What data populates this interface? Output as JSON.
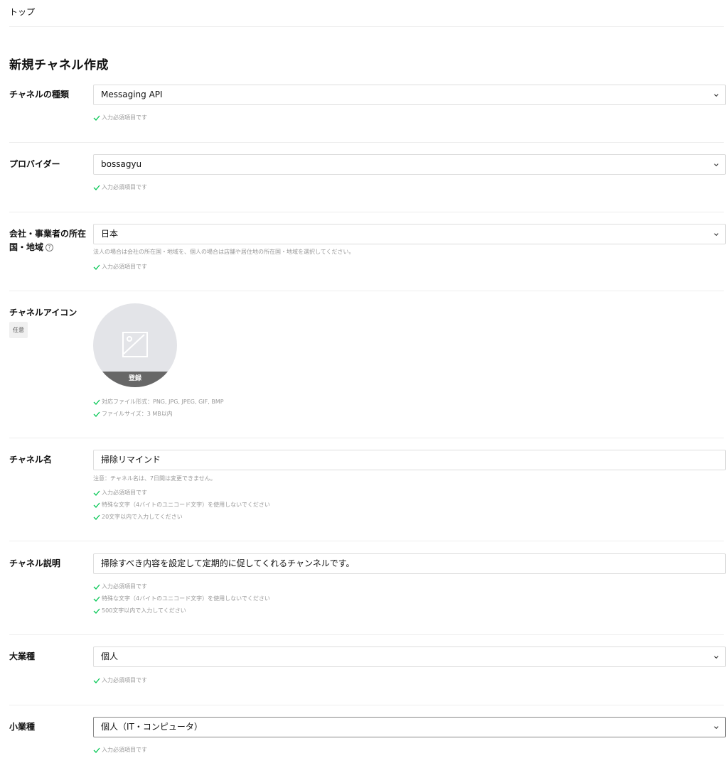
{
  "breadcrumb": "トップ",
  "page_title": "新規チャネル作成",
  "colors": {
    "valid_check": "#06c755",
    "border": "#dddddd",
    "divider": "#eeeeee"
  },
  "form": {
    "channel_type": {
      "label": "チャネルの種類",
      "value": "Messaging API",
      "valid": "入力必須項目です"
    },
    "provider": {
      "label": "プロバイダー",
      "value": "bossagyu",
      "valid": "入力必須項目です"
    },
    "country": {
      "label": "会社・事業者の所在国・地域",
      "help_icon": "help-icon",
      "value": "日本",
      "note": "法人の場合は会社の所在国・地域を、個人の場合は店舗や居住地の所在国・地域を選択してください。",
      "valid": "入力必須項目です"
    },
    "channel_icon": {
      "label": "チャネルアイコン",
      "badge": "任意",
      "register_label": "登録",
      "valid_1": "対応ファイル形式：PNG, JPG, JPEG, GIF, BMP",
      "valid_2": "ファイルサイズ：3 MB以内"
    },
    "channel_name": {
      "label": "チャネル名",
      "value": "掃除リマインド",
      "note": "注意：チャネル名は、7日間は変更できません。",
      "valid_1": "入力必須項目です",
      "valid_2": "特殊な文字（4バイトのユニコード文字）を使用しないでください",
      "valid_3": "20文字以内で入力してください"
    },
    "channel_description": {
      "label": "チャネル説明",
      "value": "掃除すべき内容を設定して定期的に促してくれるチャンネルです。",
      "valid_1": "入力必須項目です",
      "valid_2": "特殊な文字（4バイトのユニコード文字）を使用しないでください",
      "valid_3": "500文字以内で入力してください"
    },
    "major_industry": {
      "label": "大業種",
      "value": "個人",
      "valid": "入力必須項目です"
    },
    "minor_industry": {
      "label": "小業種",
      "value": "個人（IT・コンピュータ）",
      "valid": "入力必須項目です"
    }
  }
}
